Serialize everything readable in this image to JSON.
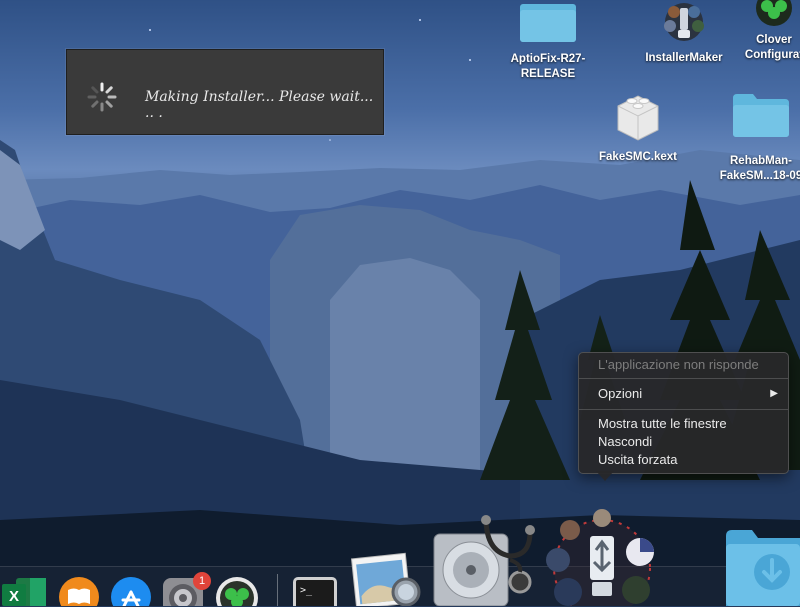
{
  "installer": {
    "message": "Making Installer... Please wait... .. ."
  },
  "desktop": {
    "icons": [
      {
        "label1": "AptioFix-R27-",
        "label2": "RELEASE"
      },
      {
        "label1": "InstallerMaker",
        "label2": ""
      },
      {
        "label1": "Clover",
        "label2": "Configurat"
      },
      {
        "label1": "FakeSMC.kext",
        "label2": ""
      },
      {
        "label1": "RehabMan-",
        "label2": "FakeSM...18-09"
      }
    ]
  },
  "context_menu": {
    "header": "L'applicazione non risponde",
    "options": "Opzioni",
    "show_all": "Mostra tutte le finestre",
    "hide": "Nascondi",
    "force_quit": "Uscita forzata"
  },
  "dock": {
    "excel_letter": "X",
    "terminal_prompt": ">_",
    "system_prefs_badge": "1"
  },
  "colors": {
    "menu_bg": "#28282a",
    "badge": "#e0443a",
    "folder": "#5fb7dd"
  }
}
